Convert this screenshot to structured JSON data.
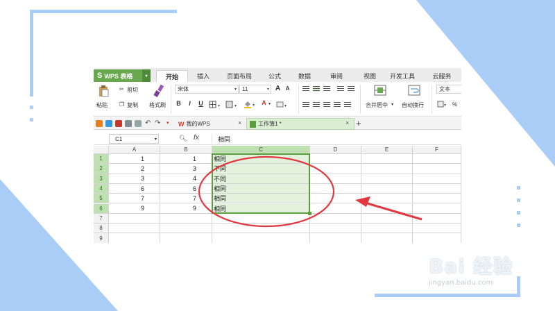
{
  "app": {
    "logo": "S",
    "title": "WPS 表格",
    "caret": "▾"
  },
  "ribbon_tabs": [
    "开始",
    "插入",
    "页面布局",
    "公式",
    "数据",
    "审阅",
    "视图",
    "开发工具",
    "云服务"
  ],
  "ribbon": {
    "cut": "剪切",
    "paste": "粘贴",
    "copy": "复制",
    "format_painter": "格式刷",
    "font_name": "宋体",
    "font_size": "11",
    "grow_font": "A",
    "shrink_font": "A",
    "bold": "B",
    "italic": "I",
    "underline": "U",
    "font_color": "A",
    "merge_center": "合并居中",
    "wrap_text": "自动换行",
    "number_format": "文本",
    "percent": "%"
  },
  "doc_tabs": {
    "my_wps": "我的WPS",
    "workbook": "工作簿1 *",
    "new_tab": "+",
    "close": "×"
  },
  "formula_bar": {
    "cell_ref": "C1",
    "fx": "fx",
    "content": "相同"
  },
  "sheet": {
    "columns": [
      "A",
      "B",
      "C",
      "D",
      "E",
      "F"
    ],
    "row_numbers": [
      "1",
      "2",
      "3",
      "4",
      "5",
      "6",
      "7",
      "8",
      "9"
    ],
    "rows": [
      [
        "1",
        "1",
        "相同"
      ],
      [
        "2",
        "3",
        "不同"
      ],
      [
        "3",
        "4",
        "不同"
      ],
      [
        "6",
        "6",
        "相同"
      ],
      [
        "7",
        "7",
        "相同"
      ],
      [
        "9",
        "9",
        "相同"
      ]
    ],
    "selection": "C1:C6"
  },
  "annotation": {
    "ellipse_color": "#e2383f",
    "arrow_color": "#e2383f"
  },
  "colors": {
    "accent_green": "#6aa84f",
    "selection_fill": "#e3f2dc",
    "deco_blue": "#a9cdf6"
  },
  "watermark": {
    "logo": "Bai 经验",
    "url": "jingyan.baidu.com"
  }
}
